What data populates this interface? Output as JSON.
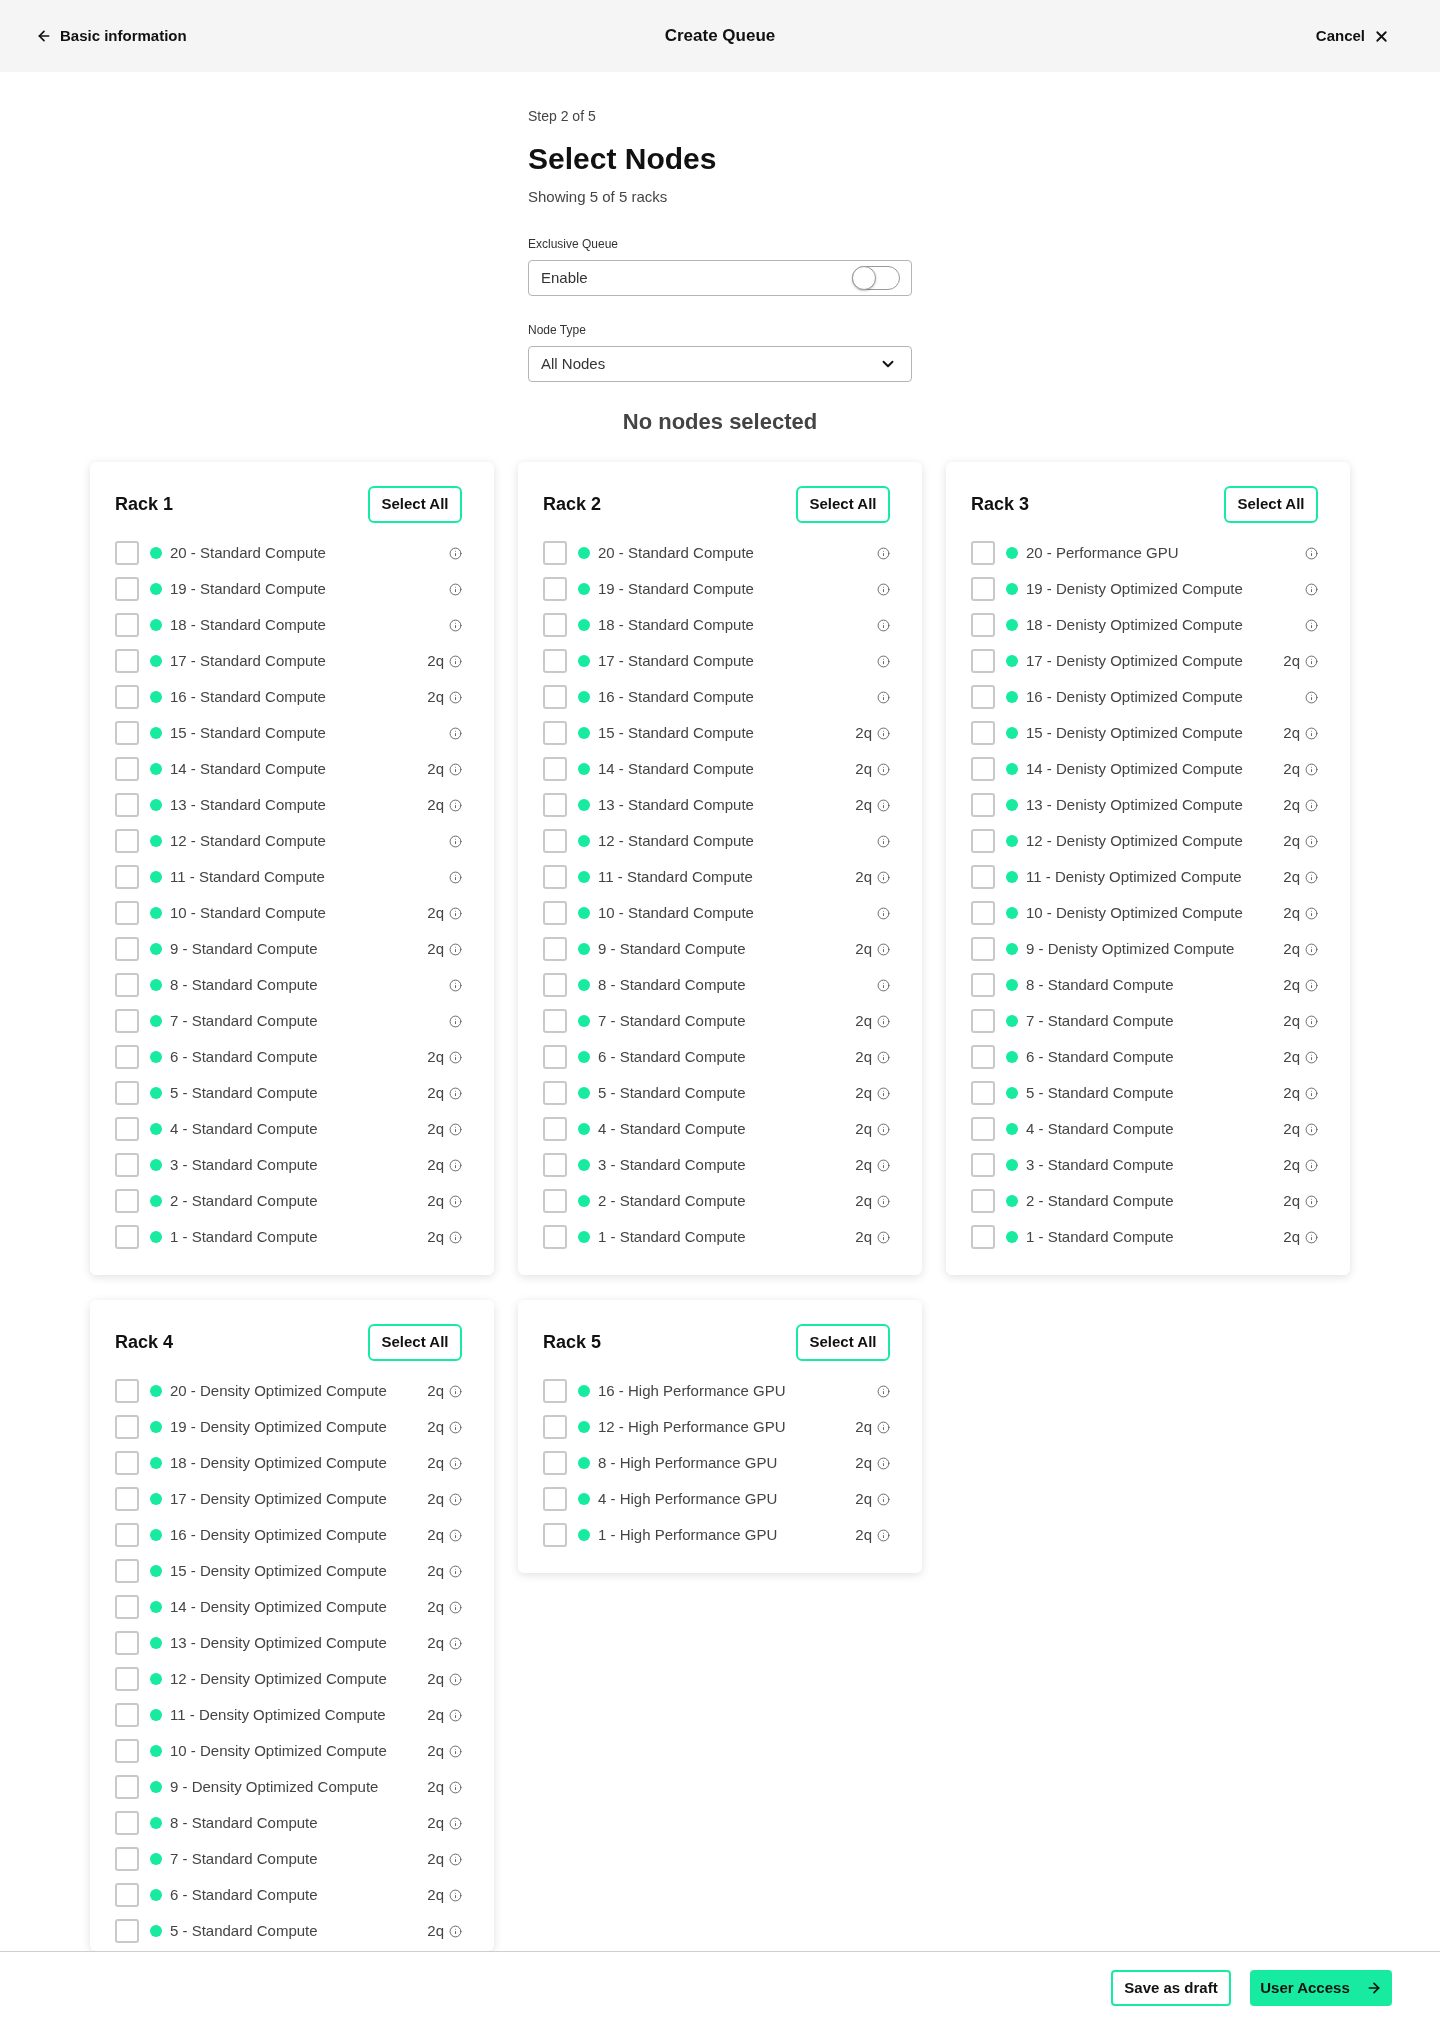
{
  "header": {
    "back_link": "Basic information",
    "title": "Create Queue",
    "cancel": "Cancel"
  },
  "step": "Step 2 of 5",
  "heading": "Select Nodes",
  "subtitle": "Showing 5 of 5 racks",
  "exclusive_queue": {
    "label": "Exclusive Queue",
    "text": "Enable",
    "on": false
  },
  "node_type": {
    "label": "Node Type",
    "value": "All Nodes"
  },
  "selection_status": "No nodes selected",
  "racks": [
    {
      "title": "Rack 1",
      "select_all": "Select All",
      "rows": [
        {
          "label": "20 - Standard Compute",
          "checked": false
        },
        {
          "label": "19 - Standard Compute",
          "checked": false
        },
        {
          "label": "18 - Standard Compute",
          "checked": false
        },
        {
          "label": "17 - Standard Compute",
          "queue": "2q",
          "checked": false
        },
        {
          "label": "16 - Standard Compute",
          "queue": "2q",
          "checked": false
        },
        {
          "label": "15 - Standard Compute",
          "checked": false
        },
        {
          "label": "14 - Standard Compute",
          "queue": "2q",
          "checked": false
        },
        {
          "label": "13 - Standard Compute",
          "queue": "2q",
          "checked": false
        },
        {
          "label": "12 - Standard Compute",
          "checked": false
        },
        {
          "label": "11 - Standard Compute",
          "checked": false
        },
        {
          "label": "10 - Standard Compute",
          "queue": "2q",
          "checked": false
        },
        {
          "label": "9 - Standard Compute",
          "queue": "2q",
          "checked": false
        },
        {
          "label": "8 - Standard Compute",
          "checked": false
        },
        {
          "label": "7 - Standard Compute",
          "checked": false
        },
        {
          "label": "6 - Standard Compute",
          "queue": "2q",
          "checked": false
        },
        {
          "label": "5 - Standard Compute",
          "queue": "2q",
          "checked": false
        },
        {
          "label": "4 - Standard Compute",
          "queue": "2q",
          "checked": false
        },
        {
          "label": "3 - Standard Compute",
          "queue": "2q",
          "checked": false
        },
        {
          "label": "2 - Standard Compute",
          "queue": "2q",
          "checked": false
        },
        {
          "label": "1 - Standard Compute",
          "queue": "2q",
          "checked": false
        }
      ]
    },
    {
      "title": "Rack 2",
      "select_all": "Select All",
      "rows": [
        {
          "label": "20 - Standard Compute",
          "checked": false
        },
        {
          "label": "19 - Standard Compute",
          "checked": false
        },
        {
          "label": "18 - Standard Compute",
          "checked": false
        },
        {
          "label": "17 - Standard Compute",
          "checked": false
        },
        {
          "label": "16 - Standard Compute",
          "checked": false
        },
        {
          "label": "15 - Standard Compute",
          "queue": "2q",
          "checked": false
        },
        {
          "label": "14 - Standard Compute",
          "queue": "2q",
          "checked": false
        },
        {
          "label": "13 - Standard Compute",
          "queue": "2q",
          "checked": false
        },
        {
          "label": "12 - Standard Compute",
          "checked": false
        },
        {
          "label": "11 - Standard Compute",
          "queue": "2q",
          "checked": false
        },
        {
          "label": "10 - Standard Compute",
          "checked": false
        },
        {
          "label": "9 - Standard Compute",
          "queue": "2q",
          "checked": false
        },
        {
          "label": "8 - Standard Compute",
          "checked": false
        },
        {
          "label": "7 - Standard Compute",
          "queue": "2q",
          "checked": false
        },
        {
          "label": "6 - Standard Compute",
          "queue": "2q",
          "checked": false
        },
        {
          "label": "5 - Standard Compute",
          "queue": "2q",
          "checked": false
        },
        {
          "label": "4 - Standard Compute",
          "queue": "2q",
          "checked": false
        },
        {
          "label": "3 - Standard Compute",
          "queue": "2q",
          "checked": false
        },
        {
          "label": "2 - Standard Compute",
          "queue": "2q",
          "checked": false
        },
        {
          "label": "1 - Standard Compute",
          "queue": "2q",
          "checked": false
        }
      ]
    },
    {
      "title": "Rack 3",
      "select_all": "Select All",
      "rows": [
        {
          "label": "20 - Performance GPU",
          "checked": false
        },
        {
          "label": "19 - Denisty Optimized Compute",
          "checked": false
        },
        {
          "label": "18 - Denisty Optimized Compute",
          "checked": false
        },
        {
          "label": "17 - Denisty Optimized Compute",
          "queue": "2q",
          "checked": false
        },
        {
          "label": "16 - Denisty Optimized Compute",
          "checked": false
        },
        {
          "label": "15 - Denisty Optimized Compute",
          "queue": "2q",
          "checked": false
        },
        {
          "label": "14 - Denisty Optimized Compute",
          "queue": "2q",
          "checked": false
        },
        {
          "label": "13 - Denisty Optimized Compute",
          "queue": "2q",
          "checked": false
        },
        {
          "label": "12 - Denisty Optimized Compute",
          "queue": "2q",
          "checked": false
        },
        {
          "label": "11 - Denisty Optimized Compute",
          "queue": "2q",
          "checked": false
        },
        {
          "label": "10 - Denisty Optimized Compute",
          "queue": "2q",
          "checked": false
        },
        {
          "label": "9 - Denisty Optimized Compute",
          "queue": "2q",
          "checked": false
        },
        {
          "label": "8 - Standard Compute",
          "queue": "2q",
          "checked": false
        },
        {
          "label": "7 - Standard Compute",
          "queue": "2q",
          "checked": false
        },
        {
          "label": "6 - Standard Compute",
          "queue": "2q",
          "checked": false
        },
        {
          "label": "5 - Standard Compute",
          "queue": "2q",
          "checked": false
        },
        {
          "label": "4 - Standard Compute",
          "queue": "2q",
          "checked": false
        },
        {
          "label": "3 - Standard Compute",
          "queue": "2q",
          "checked": false
        },
        {
          "label": "2 - Standard Compute",
          "queue": "2q",
          "checked": false
        },
        {
          "label": "1 - Standard Compute",
          "queue": "2q",
          "checked": false
        }
      ]
    },
    {
      "title": "Rack 4",
      "select_all": "Select All",
      "rows": [
        {
          "label": "20 - Density Optimized Compute",
          "queue": "2q",
          "checked": false
        },
        {
          "label": "19 - Density Optimized Compute",
          "queue": "2q",
          "checked": false
        },
        {
          "label": "18 - Density Optimized Compute",
          "queue": "2q",
          "checked": false
        },
        {
          "label": "17 - Density Optimized Compute",
          "queue": "2q",
          "checked": false
        },
        {
          "label": "16 - Density Optimized Compute",
          "queue": "2q",
          "checked": false
        },
        {
          "label": "15 - Density Optimized Compute",
          "queue": "2q",
          "checked": false
        },
        {
          "label": "14 - Density Optimized Compute",
          "queue": "2q",
          "checked": false
        },
        {
          "label": "13 - Density Optimized Compute",
          "queue": "2q",
          "checked": false
        },
        {
          "label": "12 - Density Optimized Compute",
          "queue": "2q",
          "checked": false
        },
        {
          "label": "11 - Density Optimized Compute",
          "queue": "2q",
          "checked": false
        },
        {
          "label": "10 - Density Optimized Compute",
          "queue": "2q",
          "checked": false
        },
        {
          "label": "9 - Density Optimized Compute",
          "queue": "2q",
          "checked": false
        },
        {
          "label": "8 - Standard Compute",
          "queue": "2q",
          "checked": false
        },
        {
          "label": "7 - Standard Compute",
          "queue": "2q",
          "checked": false
        },
        {
          "label": "6 - Standard Compute",
          "queue": "2q",
          "checked": false
        },
        {
          "label": "5 - Standard Compute",
          "queue": "2q",
          "checked": false
        }
      ]
    },
    {
      "title": "Rack 5",
      "select_all": "Select All",
      "rows": [
        {
          "label": "16 - High Performance GPU",
          "checked": false
        },
        {
          "label": "12 - High Performance GPU",
          "queue": "2q",
          "checked": false
        },
        {
          "label": "8 - High Performance GPU",
          "queue": "2q",
          "checked": false
        },
        {
          "label": "4 - High Performance GPU",
          "queue": "2q",
          "checked": false
        },
        {
          "label": "1 - High Performance GPU",
          "queue": "2q",
          "checked": false
        }
      ]
    }
  ],
  "footer": {
    "buttons": [
      {
        "label": "Save as draft",
        "kind": "secondary"
      },
      {
        "label": "User Access",
        "kind": "primary"
      }
    ]
  }
}
